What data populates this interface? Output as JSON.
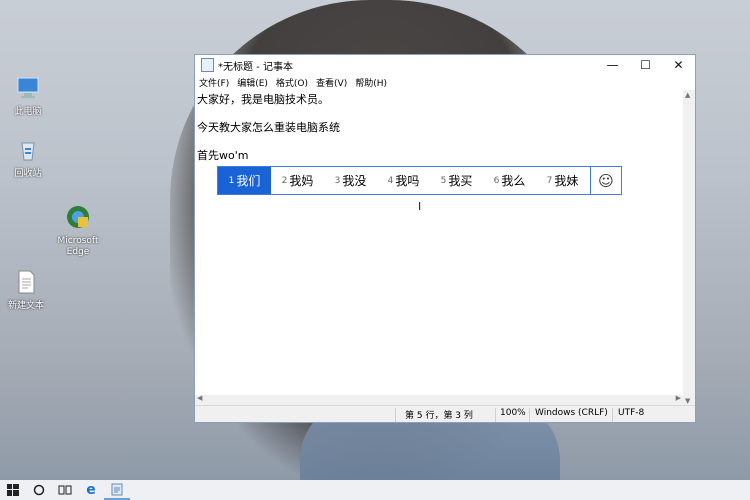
{
  "window": {
    "title": "*无标题 - 记事本",
    "controls": {
      "minimize": "—",
      "maximize": "☐",
      "close": "✕"
    }
  },
  "menu": [
    "文件(F)",
    "编辑(E)",
    "格式(O)",
    "查看(V)",
    "帮助(H)"
  ],
  "document_lines": [
    "大家好，我是电脑技术员。",
    "",
    "今天教大家怎么重装电脑系统",
    "",
    "首先wo'm"
  ],
  "ime": {
    "candidates": [
      {
        "num": "1",
        "text": "我们"
      },
      {
        "num": "2",
        "text": "我妈"
      },
      {
        "num": "3",
        "text": "我没"
      },
      {
        "num": "4",
        "text": "我吗"
      },
      {
        "num": "5",
        "text": "我买"
      },
      {
        "num": "6",
        "text": "我么"
      },
      {
        "num": "7",
        "text": "我妹"
      }
    ],
    "selected_index": 0,
    "emoji_icon": "☺"
  },
  "status": {
    "position": "第 5 行，第 3 列",
    "zoom": "100%",
    "line_ending": "Windows (CRLF)",
    "encoding": "UTF-8"
  },
  "desktop_icons": [
    {
      "label": "此电脑",
      "icon": "computer-icon"
    },
    {
      "label": "回收站",
      "icon": "recycle-bin-icon"
    },
    {
      "label": "Microsoft Edge",
      "icon": "edge-icon"
    },
    {
      "label": "新建文本",
      "icon": "text-file-icon"
    }
  ],
  "taskbar": {
    "start": "start-icon",
    "search": "cortana-icon",
    "task_view": "task-view-icon",
    "edge": "edge-icon",
    "notepad": "notepad-icon"
  },
  "colors": {
    "ime_selected": "#1a63d6",
    "window_border": "#8aa0bd"
  }
}
